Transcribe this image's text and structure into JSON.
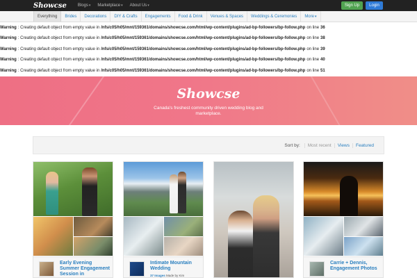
{
  "topbar": {
    "logo": "Showcse",
    "nav": [
      {
        "label": "Blogs"
      },
      {
        "label": "Marketplace"
      },
      {
        "label": "About Us"
      }
    ],
    "signup": "Sign Up",
    "login": "Login"
  },
  "categories": [
    "Everything",
    "Brides",
    "Decorations",
    "DIY & Crafts",
    "Engagements",
    "Food & Drink",
    "Venues & Spaces",
    "Weddings & Ceremonies",
    "More"
  ],
  "warnings": [
    {
      "label": "Warning",
      "text": ": Creating default object from empty value in",
      "path": "/nfs/c05/h05/mnt/159361/domains/showcse.com/html/wp-content/plugins/ad-bp-followers/bp-follow.php",
      "on": "on line",
      "line": "36"
    },
    {
      "label": "Warning",
      "text": ": Creating default object from empty value in",
      "path": "/nfs/c05/h05/mnt/159361/domains/showcse.com/html/wp-content/plugins/ad-bp-followers/bp-follow.php",
      "on": "on line",
      "line": "38"
    },
    {
      "label": "Warning",
      "text": ": Creating default object from empty value in",
      "path": "/nfs/c05/h05/mnt/159361/domains/showcse.com/html/wp-content/plugins/ad-bp-followers/bp-follow.php",
      "on": "on line",
      "line": "39"
    },
    {
      "label": "Warning",
      "text": ": Creating default object from empty value in",
      "path": "/nfs/c05/h05/mnt/159361/domains/showcse.com/html/wp-content/plugins/ad-bp-followers/bp-follow.php",
      "on": "on line",
      "line": "40"
    },
    {
      "label": "Warning",
      "text": ": Creating default object from empty value in",
      "path": "/nfs/c05/h05/mnt/159361/domains/showcse.com/html/wp-content/plugins/ad-bp-followers/bp-follow.php",
      "on": "on line",
      "line": "51"
    }
  ],
  "hero": {
    "title": "Showcse",
    "subtitle": "Canada's freshest community driven wedding blog and marketplace."
  },
  "sort": {
    "label": "Sort by:",
    "options": [
      "Most recent",
      "Views",
      "Featured"
    ]
  },
  "cards": [
    {
      "title": "Early Evening Summer Engagement Session in",
      "count": "",
      "made_by": ""
    },
    {
      "title": "Intimate Mountain Wedding",
      "count": "37 Images",
      "made_by": "Made by Kim"
    },
    {
      "title": "",
      "count": "",
      "made_by": ""
    },
    {
      "title": "Carrie + Dennis, Engagement Photos",
      "count": "",
      "made_by": ""
    }
  ],
  "colors": {
    "accent_link": "#2a7fbf",
    "signup": "#51a351",
    "login": "#2f7bd7",
    "hero_pink": "#ee6f84"
  }
}
